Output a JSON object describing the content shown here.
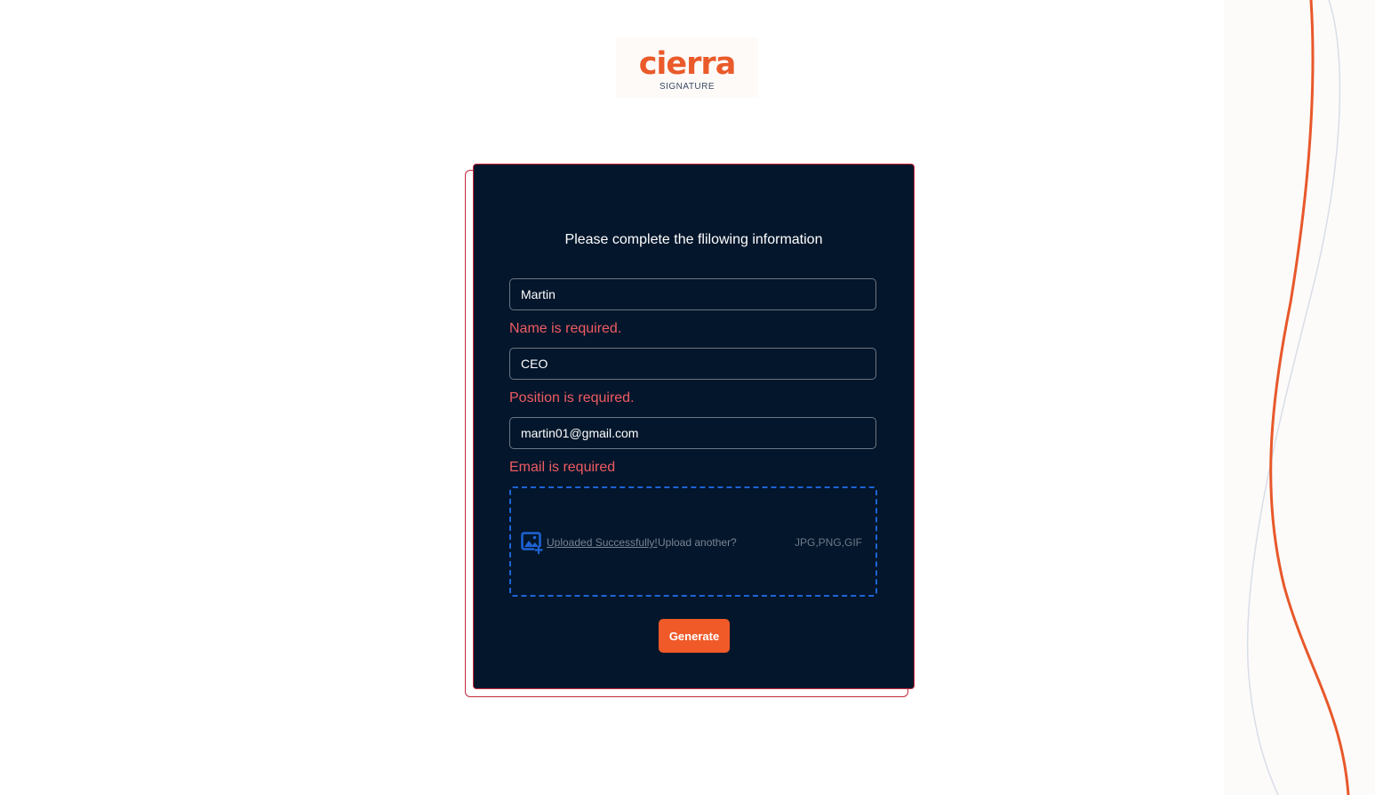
{
  "brand": {
    "logo_word": "cierra",
    "logo_sub": "SIGNATURE"
  },
  "form": {
    "heading": "Please complete the flilowing information",
    "name_value": "Martin",
    "name_error": "Name is required.",
    "position_value": "CEO",
    "position_error": "Position is required.",
    "email_value": "martin01@gmail.com",
    "email_error": "Email is required",
    "upload": {
      "icon": "image-add-icon",
      "success_text": "Uploaded Successfully!",
      "another_text": "Upload another?",
      "file_types": "JPG,PNG,GIF"
    },
    "generate_label": "Generate"
  },
  "colors": {
    "accent": "#ef5a28",
    "card_bg": "#03162b",
    "error": "#ef5b63",
    "dropzone_border": "#1e63d6"
  }
}
